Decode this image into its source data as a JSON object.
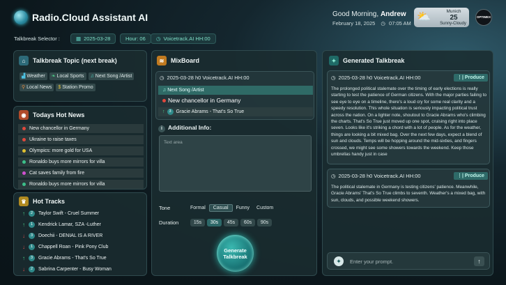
{
  "app": {
    "title": "Radio.Cloud Assistant AI"
  },
  "selector": {
    "label": "Talkbreak Selector :",
    "date": "2025-03-28",
    "hour": "Hour: 06",
    "voicetrack": "Voicetrack.AI HH:00"
  },
  "header": {
    "greeting": "Good Morning, ",
    "user": "Andrew",
    "date": "February 18, 2025",
    "time": "07:05 AM",
    "weather": {
      "city": "Munich",
      "temp": "25",
      "condition": "Sunny-Cloudy",
      "icon": "sun-cloud-icon"
    },
    "avatar_text": "OPTIMEX"
  },
  "topic": {
    "title": "Talkbreak Topic (next break)",
    "tags": [
      {
        "icon": "chart-icon",
        "label": "Weather"
      },
      {
        "icon": "leaf-icon",
        "label": "Local Sports"
      },
      {
        "icon": "music-note-icon",
        "label": "Next Song /Artist"
      },
      {
        "icon": "pin-icon",
        "label": "Local News"
      },
      {
        "icon": "dollar-icon",
        "label": "Station Promo"
      }
    ]
  },
  "hot_news": {
    "title": "Todays Hot News",
    "items": [
      {
        "label": "New chancellor in Germany",
        "color": "#e0483c"
      },
      {
        "label": "Ukraine to raise taxes",
        "color": "#e0483c"
      },
      {
        "label": "Olympics: more gold for USA",
        "color": "#e0c030"
      },
      {
        "label": "Ronaldo buys more mirrors for villa",
        "color": "#3cc08a"
      },
      {
        "label": "Cat saves family from fire",
        "color": "#d050d0"
      },
      {
        "label": "Ronaldo buys more mirrors for villa",
        "color": "#3cc08a"
      }
    ]
  },
  "hot_tracks": {
    "title": "Hot Tracks",
    "items": [
      {
        "dir": "up",
        "rank": "2",
        "label": "Taylor Swift - Cruel Summer"
      },
      {
        "dir": "up",
        "rank": "1",
        "label": "Kendrick Lamar, SZA -Luther"
      },
      {
        "dir": "down",
        "rank": "3",
        "label": "Doechii - DENIAL IS A RIVER"
      },
      {
        "dir": "down",
        "rank": "1",
        "label": "Chappell Roan - Pink Pony Club"
      },
      {
        "dir": "up",
        "rank": "3",
        "label": "Gracie Abrams - That's So True"
      },
      {
        "dir": "down",
        "rank": "2",
        "label": "Sabrina Carpenter - Busy Woman"
      }
    ]
  },
  "mixboard": {
    "title": "MixBoard",
    "slot": "2025-03-28 h0 Voicetrack.AI HH:00",
    "rows": [
      {
        "label": "Next Song /Artist"
      },
      {
        "label": "New chancellor in Germany"
      },
      {
        "label": "Gracie Abrams - That's So True"
      }
    ],
    "additional_label": "Additional Info:",
    "textarea_placeholder": "Text area",
    "tone_label": "Tone",
    "tones": [
      "Formal",
      "Casual",
      "Funny",
      "Custom"
    ],
    "tone_selected": "Casual",
    "duration_label": "Duration",
    "durations": [
      "15s",
      "30s",
      "45s",
      "60s",
      "90s"
    ],
    "duration_selected": "30s",
    "generate_label": "Generate Talkbreak"
  },
  "generated": {
    "title": "Generated Talkbreak",
    "cards": [
      {
        "slot": "2025-03-28 h0 Voicetrack.AI HH:00",
        "produce": "Produce",
        "text": "The prolonged political stalemate over the timing of early elections is really starting to test the patience of German citizens. With the major parties failing to see eye to eye on a timeline, there's a loud cry for some real clarity and a speedy resolution. This whole situation is seriously impacting political trust across the nation. On a lighter note, shoutout to Gracie Abrams who's climbing the charts. That's So True just moved up one spot, cruising right into place seven. Looks like it's striking a chord with a lot of people. As for the weather, things are looking a bit mixed bag. Over the next few days, expect a blend of sun and clouds. Temps will be hopping around the mid-sixties, and fingers crossed, we might see some showers towards the weekend. Keep those umbrellas handy just in case"
      },
      {
        "slot": "2025-03-28 h0 Voicetrack.AI HH:00",
        "produce": "Produce",
        "text": "The political stalemate in Germany is testing citizens' patience. Meanwhile, Gracie Abrams' That's So True climbs to seventh. Weather's a mixed bag, with sun, clouds, and possible weekend showers."
      }
    ],
    "prompt_placeholder": "Enter your prompt."
  }
}
